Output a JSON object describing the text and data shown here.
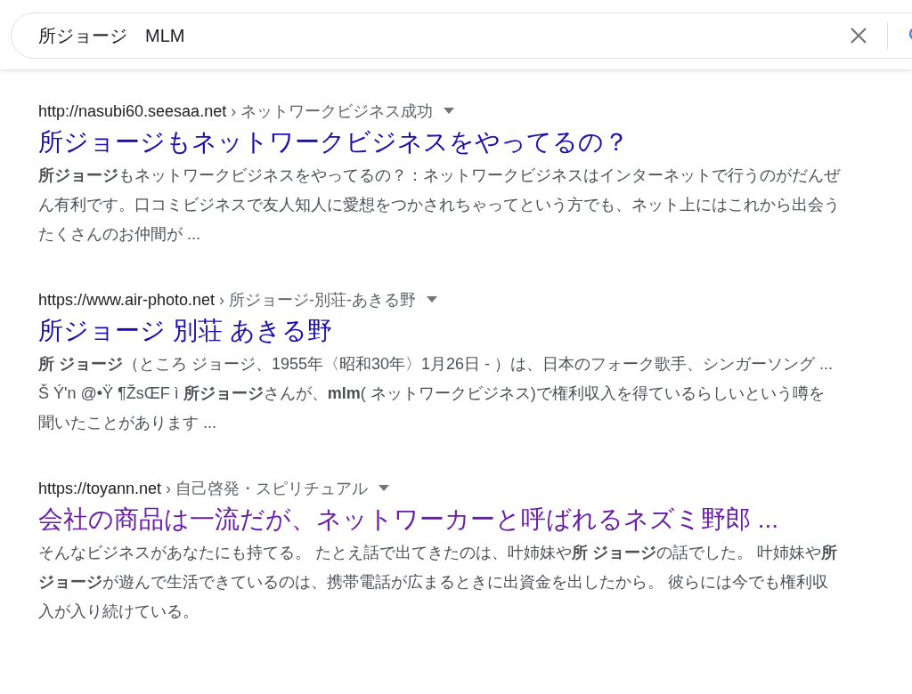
{
  "search": {
    "value": "所ジョージ　MLM"
  },
  "results": [
    {
      "url": "http://nasubi60.seesaa.net",
      "breadcrumb": "› ネットワークビジネス成功",
      "title": "所ジョージもネットワークビジネスをやってるの？",
      "visited": false,
      "snippet": "**所ジョージ**もネットワークビジネスをやってるの？：ネットワークビジネスはインターネットで行うのがだんぜん有利です。口コミビジネスで友人知人に愛想をつかされちゃってという方でも、ネット上にはこれから出会うたくさんのお仲間が ..."
    },
    {
      "url": "https://www.air-photo.net",
      "breadcrumb": "› 所ジョージ-別荘-あきる野",
      "title": "所ジョージ 別荘 あきる野",
      "visited": false,
      "snippet": "**所 ジョージ**（ところ ジョージ、1955年〈昭和30年〉1月26日 - ）は、日本のフォーク歌手、シンガーソング ... Š Ý'n @•Ÿ ¶ŽsŒF ì **所ジョージ**さんが、**mlm**( ネットワークビジネス)で権利収入を得ているらしいという噂を聞いたことがあります ..."
    },
    {
      "url": "https://toyann.net",
      "breadcrumb": "› 自己啓発・スピリチュアル",
      "title": "会社の商品は一流だが、ネットワーカーと呼ばれるネズミ野郎 ...",
      "visited": true,
      "snippet": "そんなビジネスがあなたにも持てる。 たとえ話で出てきたのは、叶姉妹や**所 ジョージ**の話でした。 叶姉妹や**所ジョージ**が遊んで生活できているのは、携帯電話が広まるときに出資金を出したから。 彼らには今でも権利収入が入り続けている。"
    }
  ]
}
